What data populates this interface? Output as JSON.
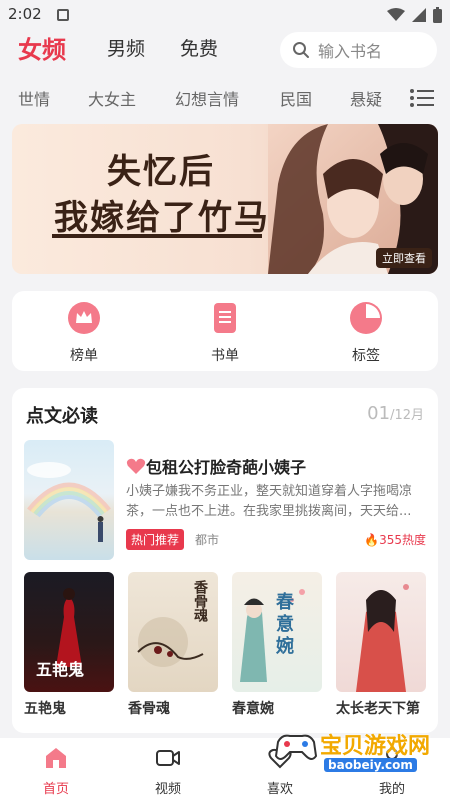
{
  "status_bar": {
    "time": "2:02"
  },
  "top_nav": {
    "channels": [
      "女频",
      "男频",
      "免费"
    ],
    "active": "女频"
  },
  "search": {
    "placeholder": "输入书名"
  },
  "genres": [
    "世情",
    "大女主",
    "幻想言情",
    "民国",
    "悬疑"
  ],
  "banner": {
    "title_line1": "失忆后",
    "title_line2": "我嫁给了竹马",
    "cta": "立即查看"
  },
  "quick_entries": [
    {
      "label": "榜单",
      "icon": "crown-icon"
    },
    {
      "label": "书单",
      "icon": "booklist-icon"
    },
    {
      "label": "标签",
      "icon": "tag-icon"
    }
  ],
  "must_read": {
    "title": "点文必读",
    "date_day": "01",
    "date_month": "/12月",
    "featured": {
      "title": "包租公打脸奇葩小姨子",
      "desc": "小姨子嫌我不务正业，整天就知道穿着人字拖喝凉茶，一点也不上进。在我家里挑拨离间，天天给...",
      "tag": "热门推荐",
      "category": "都市",
      "heat": "355热度"
    },
    "books": [
      {
        "name": "五艳鬼",
        "cover_text": "五艳鬼"
      },
      {
        "name": "香骨魂",
        "cover_text": "香骨魂"
      },
      {
        "name": "春意婉",
        "cover_text": "春意婉"
      },
      {
        "name": "太长老天下第",
        "cover_text": ""
      }
    ]
  },
  "bottom_nav": [
    {
      "label": "首页",
      "icon": "home-icon",
      "active": true
    },
    {
      "label": "视频",
      "icon": "video-icon",
      "active": false
    },
    {
      "label": "喜欢",
      "icon": "heart-icon",
      "active": false
    },
    {
      "label": "我的",
      "icon": "user-icon",
      "active": false
    }
  ],
  "watermark": {
    "text": "宝贝游戏网",
    "url": "baobeiy.com"
  },
  "colors": {
    "accent": "#e8394d",
    "background": "#f3f3f5"
  }
}
